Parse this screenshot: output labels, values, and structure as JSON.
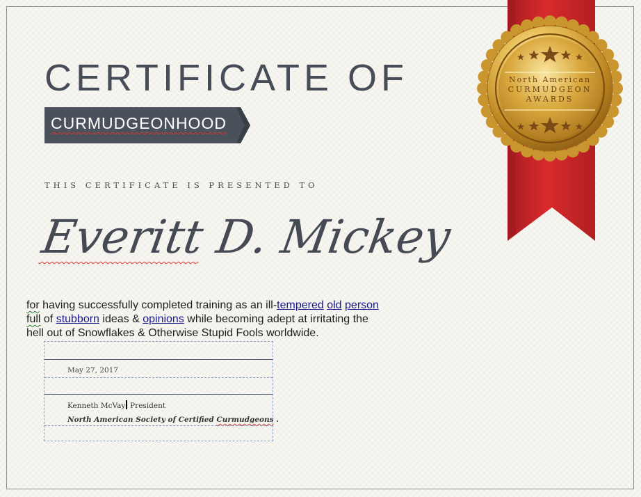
{
  "certificate": {
    "title": "CERTIFICATE OF",
    "banner": "CURMUDGEONHOOD",
    "presented_to": "THIS CERTIFICATE IS PRESENTED TO",
    "recipient_first": "Everitt",
    "recipient_rest": " D. Mickey",
    "body": {
      "t1": "for",
      "t2": " having successfully completed training as an ill-",
      "t3": "tempered",
      "t4": "old",
      "t5": "person",
      "t6": "full",
      "t7": " of ",
      "t8": "stubborn",
      "t9": " ideas & ",
      "t10": "opinions",
      "t11": " while becoming adept at irritating the",
      "t12": "hell out of Snowflakes & Otherwise Stupid Fools worldwide."
    },
    "date": "May 27, 2017",
    "signer_name": "Kenneth McVay",
    "signer_title": " President",
    "org_prefix": "North American Society of Certified ",
    "org_word": "Curmudgeons",
    "org_suffix": " ."
  },
  "seal": {
    "line1": "North American",
    "line2": "CURMUDGEON",
    "line3": "AWARDS"
  },
  "colors": {
    "ink": "#464c58",
    "banner_bg": "#4b515b",
    "ribbon_red": "#c8272b",
    "gold": "#d4a63a"
  }
}
